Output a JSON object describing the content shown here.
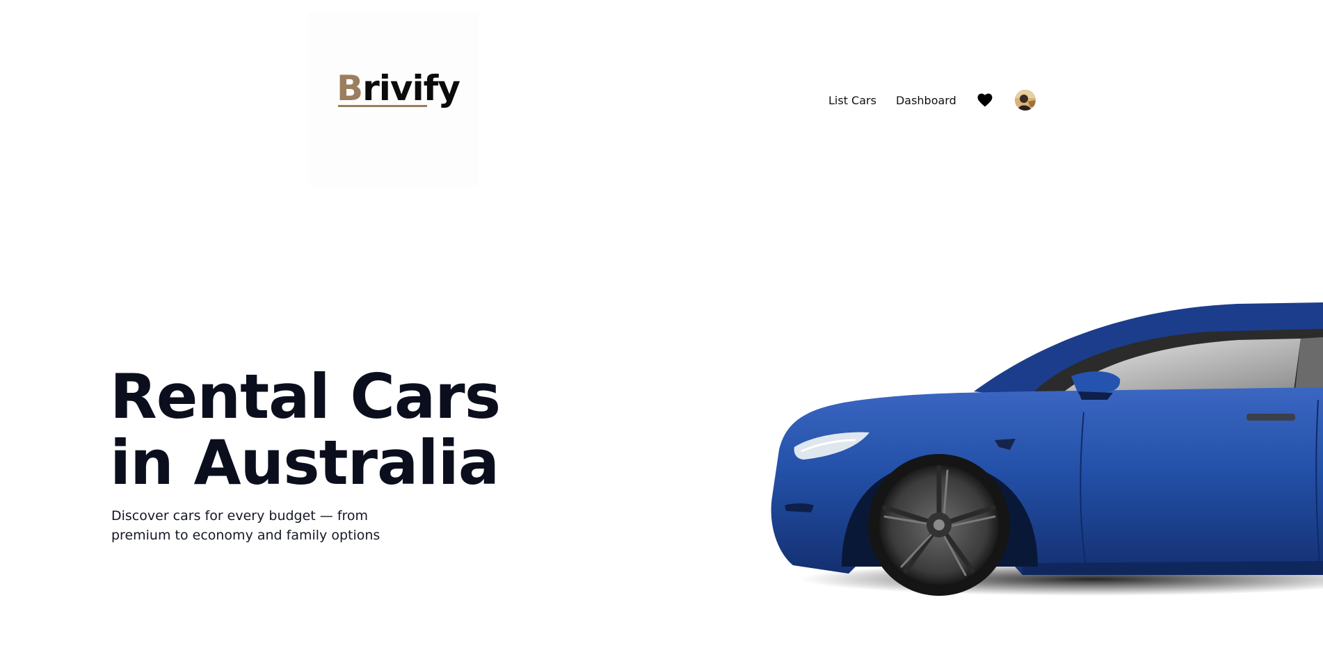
{
  "header": {
    "logo": {
      "first_letter": "B",
      "rest": "rivify",
      "accent_color": "#9a7e5d"
    },
    "nav": {
      "list_cars": "List Cars",
      "dashboard": "Dashboard"
    },
    "icons": {
      "favorites": "heart-icon",
      "profile": "avatar"
    }
  },
  "hero": {
    "title_line1": "Rental Cars",
    "title_line2": "in Australia",
    "subtitle": "Discover cars for every budget — from premium to economy and family options",
    "image": "blue-sedan-car-image"
  },
  "colors": {
    "text": "#0b0f1d",
    "brand_gold": "#9a7e5d",
    "car_blue": "#1f4aa0"
  }
}
